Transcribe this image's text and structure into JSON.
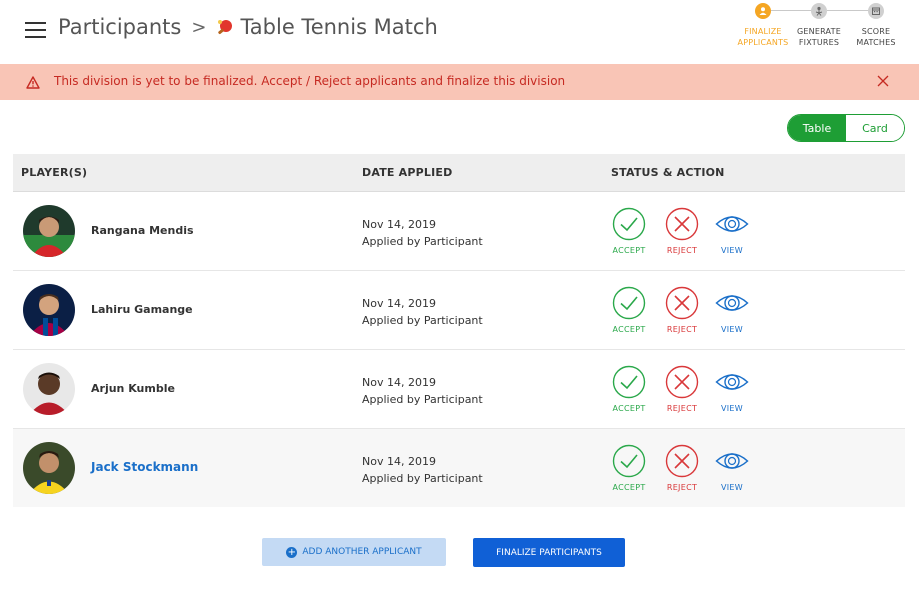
{
  "header": {
    "breadcrumb_root": "Participants",
    "breadcrumb_current": "Table Tennis Match"
  },
  "steps": [
    {
      "line1": "FINALIZE",
      "line2": "APPLICANTS",
      "active": true,
      "icon": "user-icon"
    },
    {
      "line1": "GENERATE",
      "line2": "FIXTURES",
      "active": false,
      "icon": "fixture-icon"
    },
    {
      "line1": "SCORE",
      "line2": "MATCHES",
      "active": false,
      "icon": "calendar-icon"
    }
  ],
  "alert": {
    "message": "This division is yet to be finalized. Accept / Reject applicants and finalize this division"
  },
  "view_toggle": {
    "table": "Table",
    "card": "Card",
    "selected": "Table"
  },
  "table": {
    "headers": {
      "player": "PLAYER(S)",
      "date": "DATE APPLIED",
      "status": "STATUS & ACTION"
    },
    "actions": {
      "accept": "ACCEPT",
      "reject": "REJECT",
      "view": "VIEW"
    },
    "rows": [
      {
        "name": "Rangana Mendis",
        "date": "Nov 14, 2019",
        "applied_by": "Applied by Participant"
      },
      {
        "name": "Lahiru Gamange",
        "date": "Nov 14, 2019",
        "applied_by": "Applied by Participant"
      },
      {
        "name": "Arjun Kumble",
        "date": "Nov 14, 2019",
        "applied_by": "Applied by Participant"
      },
      {
        "name": "Jack Stockmann",
        "date": "Nov 14, 2019",
        "applied_by": "Applied by Participant"
      }
    ]
  },
  "buttons": {
    "add": "ADD ANOTHER APPLICANT",
    "finalize": "FINALIZE PARTICIPANTS"
  },
  "colors": {
    "accept": "#2aa84a",
    "reject": "#d9383a",
    "view": "#1a6fc9",
    "active_step": "#f5a623",
    "primary": "#1060d6"
  }
}
